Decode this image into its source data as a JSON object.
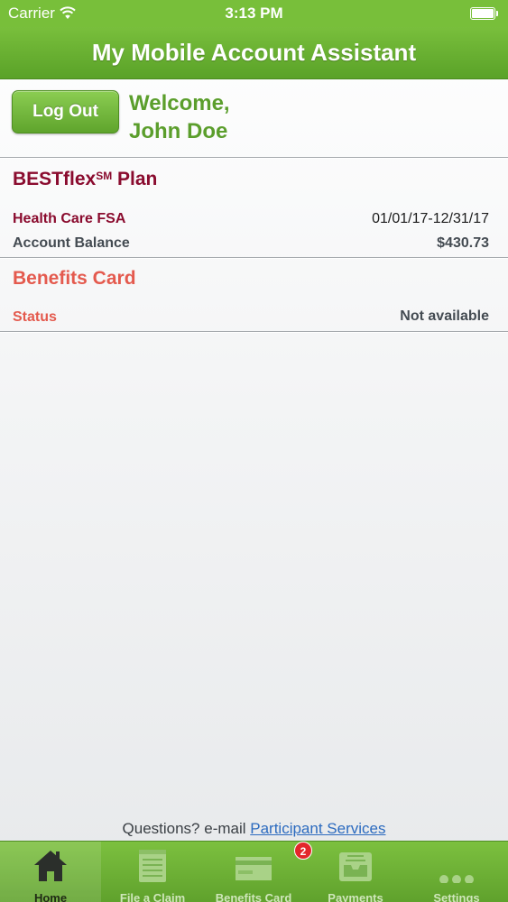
{
  "status_bar": {
    "carrier": "Carrier",
    "time": "3:13 PM"
  },
  "nav": {
    "title": "My Mobile Account Assistant"
  },
  "welcome": {
    "logout_label": "Log Out",
    "line1": "Welcome,",
    "line2": "John Doe"
  },
  "plan": {
    "title": "BESTflex",
    "title_mark": "SM",
    "title_suffix": " Plan",
    "account_name": "Health Care FSA",
    "date_range": "01/01/17-12/31/17",
    "balance_label": "Account Balance",
    "balance_value": "$430.73"
  },
  "benefits_card": {
    "title": "Benefits Card",
    "status_label": "Status",
    "status_value": "Not available"
  },
  "footer": {
    "question_text": "Questions? e-mail ",
    "link_text": "Participant Services"
  },
  "tabs": [
    {
      "label": "Home",
      "icon": "home-icon"
    },
    {
      "label": "File a Claim",
      "icon": "notepad-icon"
    },
    {
      "label": "Benefits Card",
      "icon": "card-icon",
      "badge": "2"
    },
    {
      "label": "Payments",
      "icon": "inbox-tray-icon"
    },
    {
      "label": "Settings",
      "icon": "more-dots-icon"
    }
  ],
  "colors": {
    "brand_green": "#78bf3a",
    "plan_title": "#8a0b2e",
    "card_title": "#e45a4e",
    "welcome_green": "#5b9e2c",
    "badge_red": "#e3262b"
  }
}
